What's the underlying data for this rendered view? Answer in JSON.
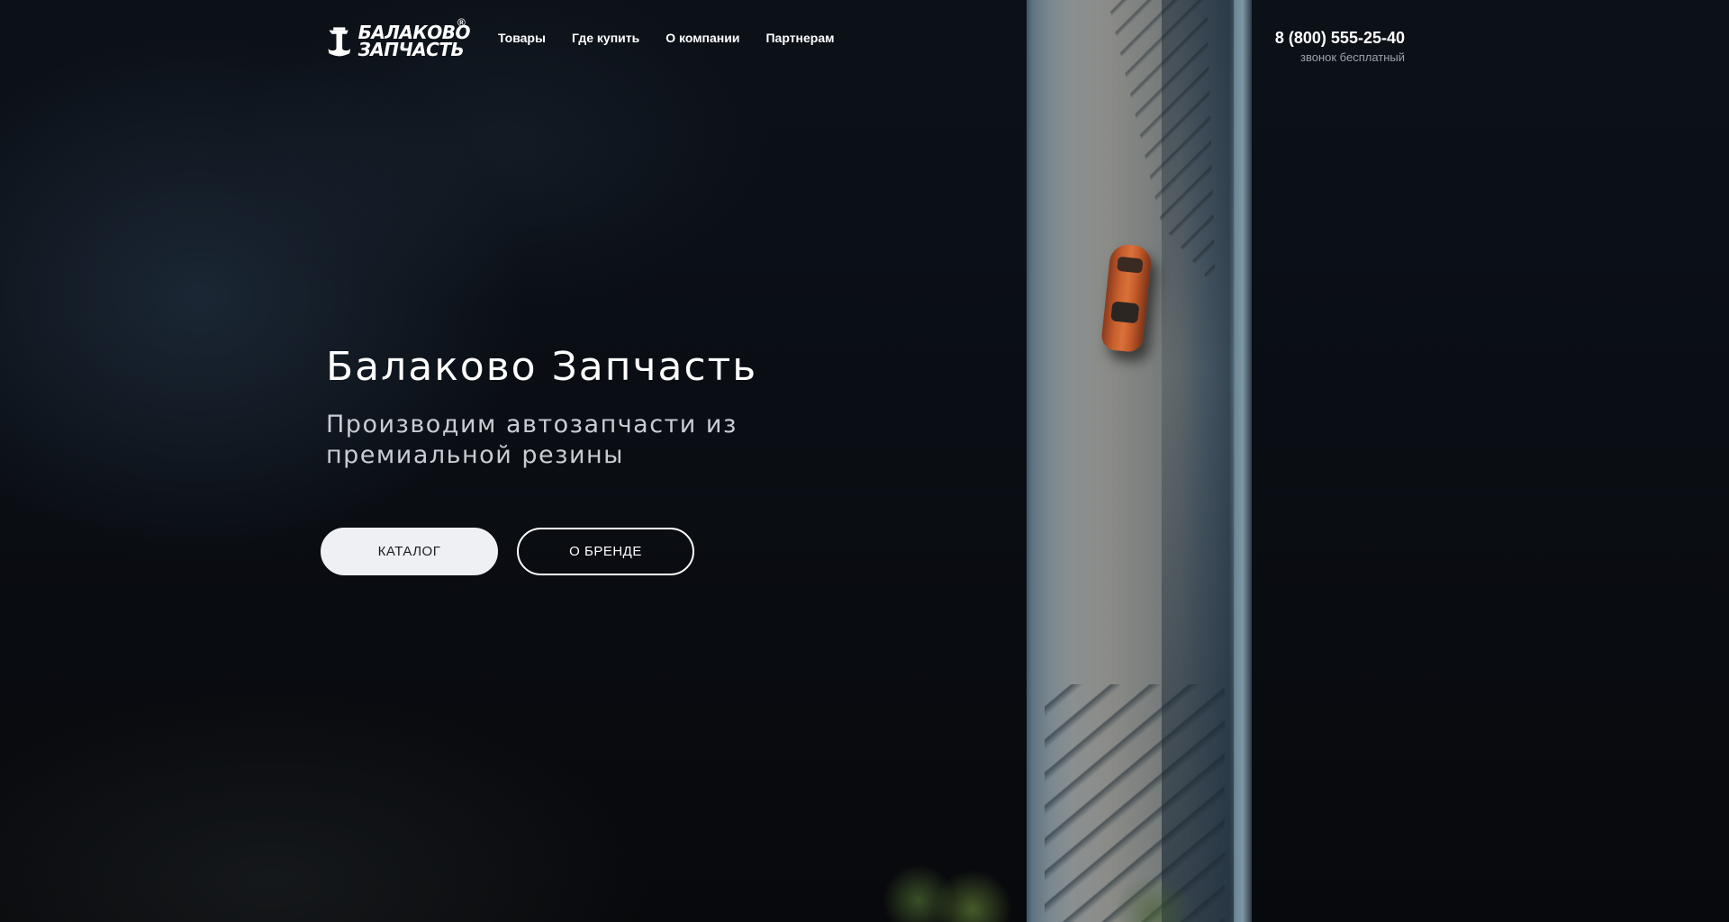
{
  "brand": {
    "logo_line1": "БАЛАКОВО",
    "logo_line2": "ЗАПЧАСТЬ",
    "registered_mark": "®",
    "logo_icon": "ship-anchor-icon"
  },
  "nav": {
    "items": [
      {
        "label": "Товары"
      },
      {
        "label": "Где купить"
      },
      {
        "label": "О компании"
      },
      {
        "label": "Партнерам"
      }
    ]
  },
  "contact": {
    "phone": "8 (800) 555-25-40",
    "note": "звонок бесплатный"
  },
  "hero": {
    "title": "Балаково Запчасть",
    "subtitle": "Производим автозапчасти из премиальной резины",
    "primary_button": "КАТАЛОГ",
    "secondary_button": "О БРЕНДЕ"
  },
  "colors": {
    "background": "#0a0d12",
    "primary_button_bg": "#eef0f4",
    "text": "#ffffff",
    "muted_text": "#9aa3ad"
  }
}
